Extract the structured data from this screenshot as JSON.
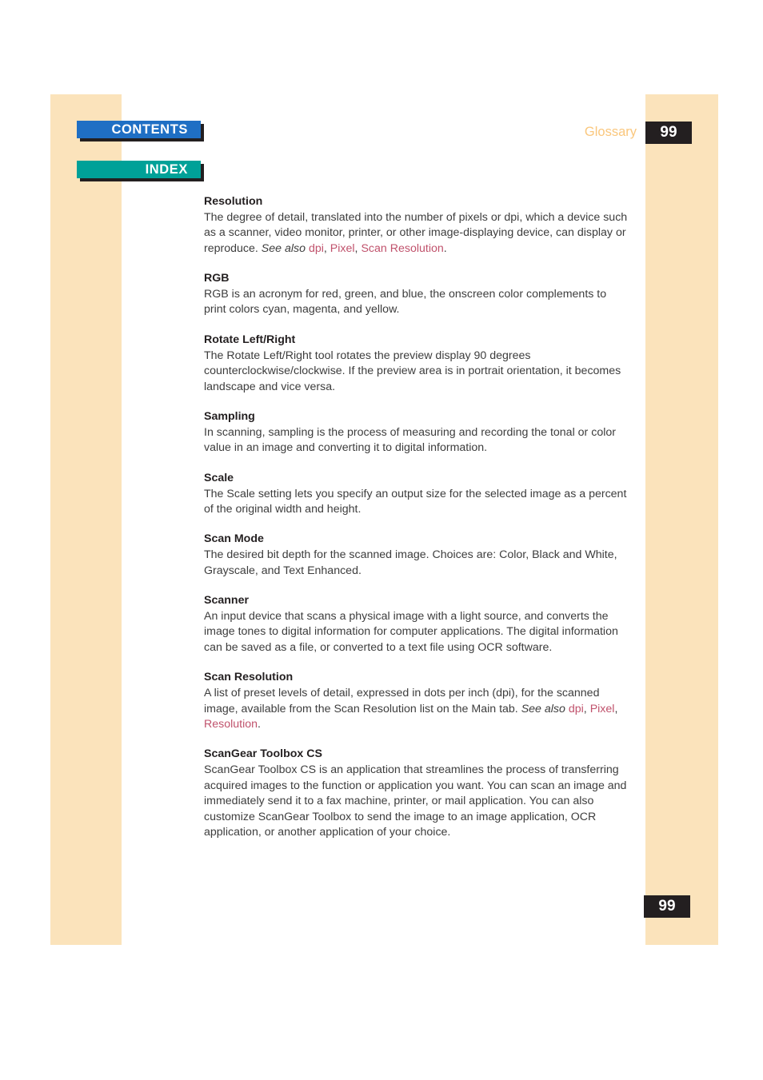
{
  "nav": {
    "contents_label": "CONTENTS",
    "index_label": "INDEX"
  },
  "header": {
    "section_label": "Glossary",
    "page_number": "99"
  },
  "footer": {
    "page_number": "99"
  },
  "colors": {
    "contents_button": "#1f6fc4",
    "index_button": "#00a198",
    "margin_strip": "#fbe3bb",
    "page_badge": "#231f20",
    "section_label": "#fac77d",
    "cross_reference": "#c0526c"
  },
  "glossary": {
    "entries": [
      {
        "term": "Resolution",
        "definition": "The degree of detail, translated into the number of pixels or dpi, which a device such as a scanner, video monitor, printer, or other image-displaying device, can display or reproduce. ",
        "see_also_label": "See also",
        "see_also": [
          "dpi",
          "Pixel",
          "Scan Resolution"
        ]
      },
      {
        "term": "RGB",
        "definition": "RGB is an acronym for red, green, and blue, the onscreen color complements to print colors cyan, magenta, and yellow."
      },
      {
        "term": "Rotate Left/Right",
        "definition": "The Rotate Left/Right tool rotates the preview display 90 degrees counterclockwise/clockwise. If the preview area is in portrait orientation, it becomes landscape and vice versa."
      },
      {
        "term": "Sampling",
        "definition": "In scanning, sampling is the process of measuring and recording the tonal or color value in an image and converting it to digital information."
      },
      {
        "term": "Scale",
        "definition": "The Scale setting lets you specify an output size for the selected image as a percent of the original width and height."
      },
      {
        "term": "Scan Mode",
        "definition": "The desired bit depth for the scanned image. Choices are: Color, Black and White, Grayscale, and Text Enhanced."
      },
      {
        "term": "Scanner",
        "definition": "An input device that scans a physical image with a light source, and converts the image tones to digital information for computer applications. The digital information can be saved as a file, or converted to a text file using OCR software."
      },
      {
        "term": "Scan Resolution",
        "definition": "A list of preset levels of detail, expressed in dots per inch (dpi), for the scanned image, available from the Scan Resolution list on the Main tab. ",
        "see_also_label": "See also",
        "see_also": [
          "dpi",
          "Pixel",
          "Resolution"
        ]
      },
      {
        "term": "ScanGear Toolbox CS",
        "definition": "ScanGear Toolbox CS is an application that streamlines the process of transferring acquired images to the function or application you want. You can scan an image and immediately send it to a fax machine, printer, or mail application. You can also customize ScanGear Toolbox to send the image to an image application, OCR application, or another application of your choice."
      }
    ]
  }
}
